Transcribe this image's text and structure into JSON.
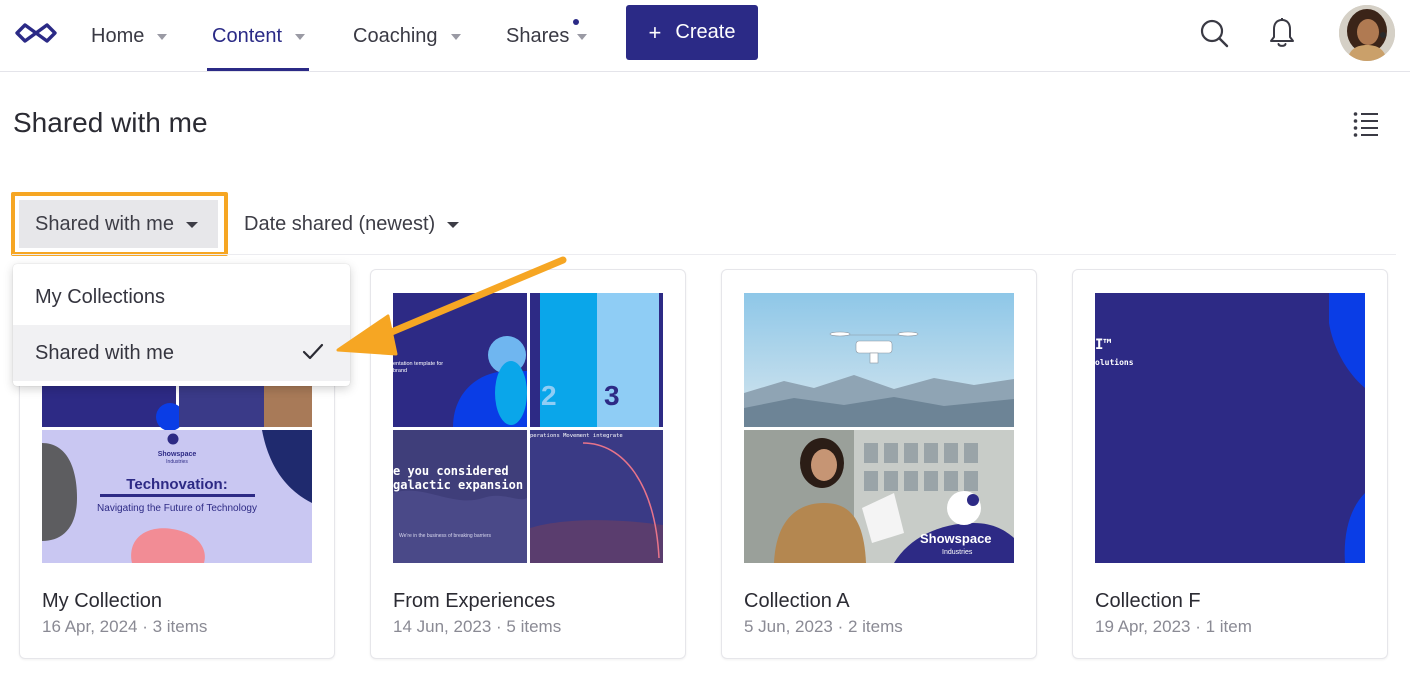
{
  "nav": {
    "logo": "infinity-logo",
    "items": [
      {
        "label": "Home",
        "active": false
      },
      {
        "label": "Content",
        "active": true
      },
      {
        "label": "Coaching",
        "active": false
      },
      {
        "label": "Shares",
        "active": false,
        "has_notification_dot": true
      }
    ],
    "create_label": "Create",
    "icons": [
      "search-icon",
      "bell-icon",
      "avatar"
    ]
  },
  "page": {
    "title": "Shared with me"
  },
  "filters": {
    "scope_label": "Shared with me",
    "sort_label": "Date shared (newest)"
  },
  "dropdown": {
    "options": [
      {
        "label": "My Collections",
        "selected": false
      },
      {
        "label": "Shared with me",
        "selected": true
      }
    ]
  },
  "cards": [
    {
      "title": "My Collection",
      "meta": "16 Apr, 2024 · 3 items",
      "thumb": {
        "brand": "Showspace",
        "brand_sub": "Industries",
        "headline": "Technovation:",
        "subheadline": "Navigating the Future of Technology"
      }
    },
    {
      "title": "From Experiences",
      "meta": "14 Jun, 2023 · 5 items",
      "thumb": {
        "tile1_text_a": "entation template for",
        "tile1_text_b": "brand",
        "num_a": "2",
        "num_b": "3",
        "tile3_line1": "e you considered",
        "tile3_line2": "galactic expansion",
        "tile3_small": "We're in the business of breaking barriers",
        "tile4_text": "perations Movement integrate"
      }
    },
    {
      "title": "Collection A",
      "meta": "5 Jun, 2023 · 2 items",
      "thumb": {
        "brand": "Showspace",
        "brand_sub": "Industries"
      }
    },
    {
      "title": "Collection F",
      "meta": "19 Apr, 2023 · 1 item",
      "thumb": {
        "text_a": "I™",
        "text_b": "olutions"
      }
    }
  ],
  "colors": {
    "brand_navy": "#2b2a86",
    "highlight_orange": "#f6a623",
    "card_blue": "#2d2a85",
    "bright_blue": "#0a3de6",
    "sky_blue": "#8fcdf5"
  }
}
